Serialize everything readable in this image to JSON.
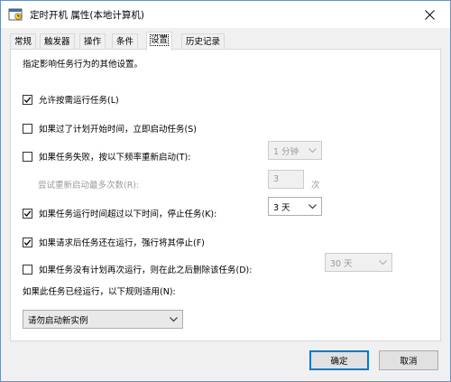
{
  "window": {
    "title": "定时开机 属性(本地计算机)"
  },
  "tabs": [
    {
      "label": "常规"
    },
    {
      "label": "触发器"
    },
    {
      "label": "操作"
    },
    {
      "label": "条件"
    },
    {
      "label": "设置"
    },
    {
      "label": "历史记录"
    }
  ],
  "settings": {
    "description": "指定影响任务行为的其他设置。",
    "allow_on_demand": {
      "label": "允许按需运行任务(L)",
      "checked": true
    },
    "run_missed": {
      "label": "如果过了计划开始时间，立即启动任务(S)",
      "checked": false
    },
    "restart_on_fail": {
      "label": "如果任务失败，按以下频率重新启动(T):",
      "checked": false,
      "interval": "1 分钟"
    },
    "retry": {
      "label": "尝试重新启动最多次数(R):",
      "value": "3",
      "unit": "次"
    },
    "stop_if_longer": {
      "label": "如果任务运行时间超过以下时间，停止任务(K):",
      "checked": true,
      "duration": "3 天"
    },
    "force_stop": {
      "label": "如果请求后任务还在运行，强行将其停止(F)",
      "checked": true
    },
    "delete_if_not_scheduled": {
      "label": "如果任务没有计划再次运行，则在此之后删除该任务(D):",
      "checked": false,
      "duration": "30 天"
    },
    "rule_label": "如果此任务已经运行，以下规则适用(N):",
    "rule_value": "请勿启动新实例"
  },
  "buttons": {
    "ok": "确定",
    "cancel": "取消"
  },
  "colors": {
    "accent": "#0078d7",
    "panel_border": "#d9d9d9",
    "disabled_text": "#9a9a9a"
  }
}
